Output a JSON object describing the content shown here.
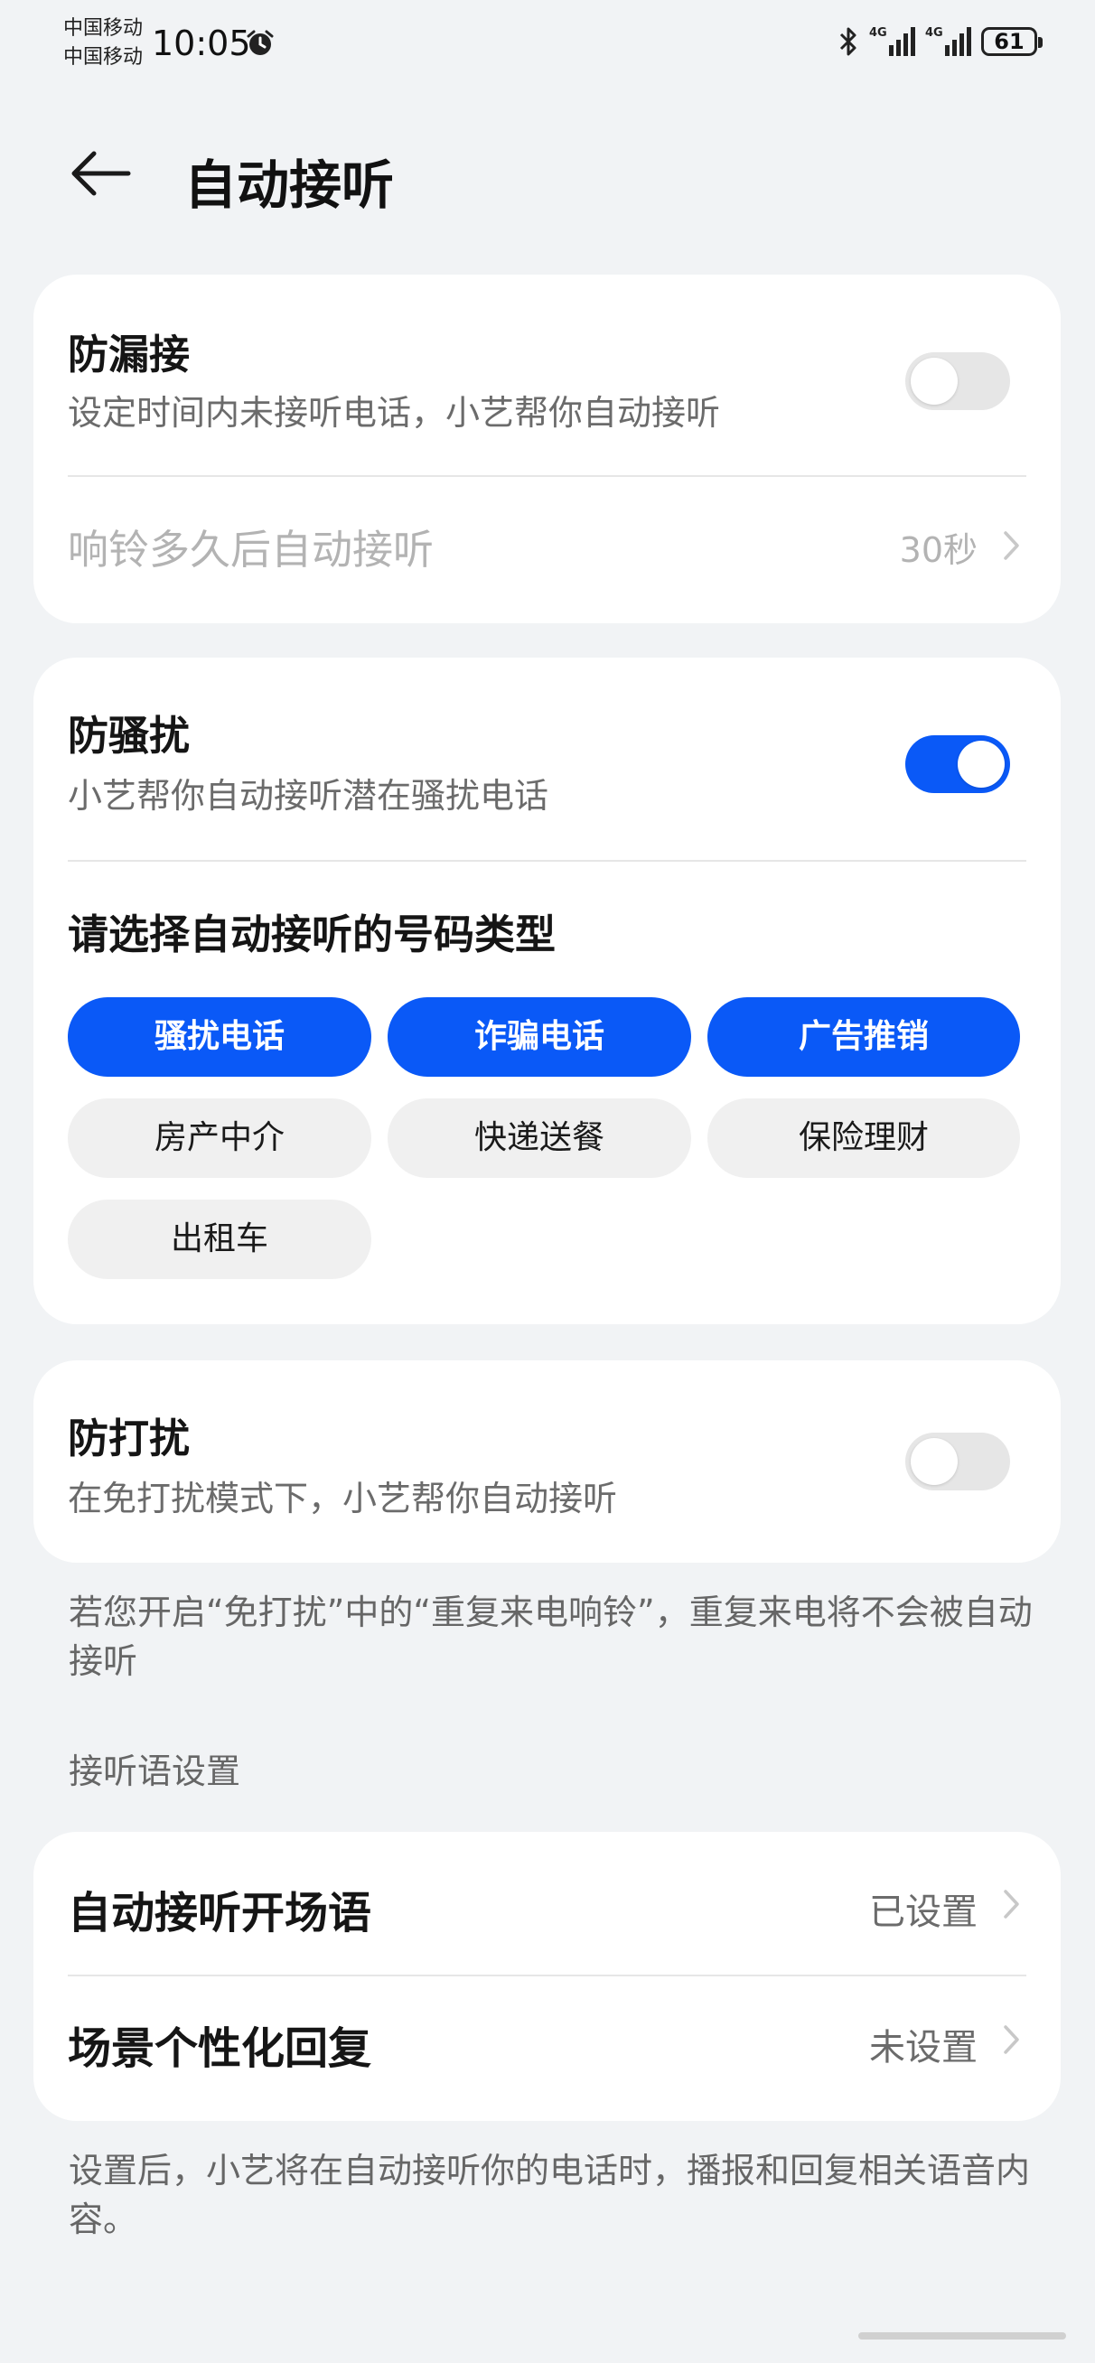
{
  "status_bar": {
    "carrier_1": "中国移动",
    "carrier_2": "中国移动",
    "time": "10:05",
    "network_1": "4G",
    "network_2": "4G",
    "battery": "61",
    "icons": [
      "alarm-icon",
      "bluetooth-icon",
      "signal-icon",
      "signal-icon",
      "battery-icon"
    ]
  },
  "header": {
    "back_icon": "back-arrow-icon",
    "title": "自动接听"
  },
  "missed_call_card": {
    "title": "防漏接",
    "subtitle": "设定时间内未接听电话，小艺帮你自动接听",
    "toggle_on": false,
    "delay_label": "响铃多久后自动接听",
    "delay_value": "30秒"
  },
  "harassment_card": {
    "title": "防骚扰",
    "subtitle": "小艺帮你自动接听潜在骚扰电话",
    "toggle_on": true,
    "question": "请选择自动接听的号码类型",
    "chips": [
      {
        "label": "骚扰电话",
        "selected": true
      },
      {
        "label": "诈骗电话",
        "selected": true
      },
      {
        "label": "广告推销",
        "selected": true
      },
      {
        "label": "房产中介",
        "selected": false
      },
      {
        "label": "快递送餐",
        "selected": false
      },
      {
        "label": "保险理财",
        "selected": false
      },
      {
        "label": "出租车",
        "selected": false
      }
    ]
  },
  "dnd_card": {
    "title": "防打扰",
    "subtitle": "在免打扰模式下，小艺帮你自动接听",
    "toggle_on": false
  },
  "dnd_note": "若您开启“免打扰”中的“重复来电响铃”，重复来电将不会被自动接听",
  "greeting_section": {
    "label": "接听语设置",
    "rows": [
      {
        "label": "自动接听开场语",
        "value": "已设置"
      },
      {
        "label": "场景个性化回复",
        "value": "未设置"
      }
    ],
    "note": "设置后，小艺将在自动接听你的电话时，播报和回复相关语音内容。"
  },
  "colors": {
    "accent": "#0a59f7",
    "background": "#f1f3f5",
    "card": "#ffffff",
    "secondary_text": "#6b6b6b",
    "disabled_text": "#b3b3b3"
  }
}
